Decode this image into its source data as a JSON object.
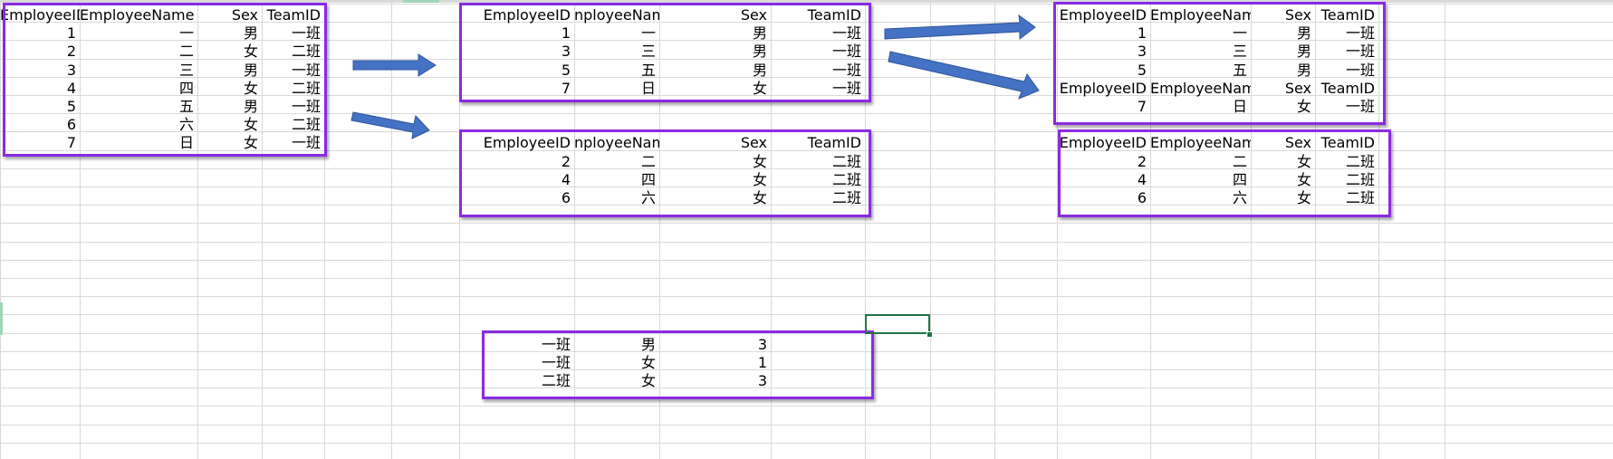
{
  "colors": {
    "highlight_border": "#8a2be2",
    "arrow_fill": "#4472c4",
    "selection": "#217346",
    "gridline": "#d9d9d9"
  },
  "sheet": {
    "source_table": {
      "headers": [
        "EmployeeID",
        "EmployeeName",
        "Sex",
        "TeamID"
      ],
      "rows": [
        [
          "1",
          "一",
          "男",
          "一班"
        ],
        [
          "2",
          "二",
          "女",
          "二班"
        ],
        [
          "3",
          "三",
          "男",
          "一班"
        ],
        [
          "4",
          "四",
          "女",
          "二班"
        ],
        [
          "5",
          "五",
          "男",
          "一班"
        ],
        [
          "6",
          "六",
          "女",
          "二班"
        ],
        [
          "7",
          "日",
          "女",
          "一班"
        ]
      ]
    },
    "team1_table": {
      "headers": [
        "EmployeeID",
        "nployeeName",
        "Sex",
        "TeamID"
      ],
      "rows": [
        [
          "1",
          "一",
          "男",
          "一班"
        ],
        [
          "3",
          "三",
          "男",
          "一班"
        ],
        [
          "5",
          "五",
          "男",
          "一班"
        ],
        [
          "7",
          "日",
          "女",
          "一班"
        ]
      ]
    },
    "team2_table": {
      "headers": [
        "EmployeeID",
        "nployeeName",
        "Sex",
        "TeamID"
      ],
      "rows": [
        [
          "2",
          "二",
          "女",
          "二班"
        ],
        [
          "4",
          "四",
          "女",
          "二班"
        ],
        [
          "6",
          "六",
          "女",
          "二班"
        ]
      ]
    },
    "team1_male_table": {
      "headers": [
        "EmployeeID",
        "EmployeeName",
        "Sex",
        "TeamID"
      ],
      "rows": [
        [
          "1",
          "一",
          "男",
          "一班"
        ],
        [
          "3",
          "三",
          "男",
          "一班"
        ],
        [
          "5",
          "五",
          "男",
          "一班"
        ]
      ]
    },
    "team1_female_table": {
      "headers": [
        "EmployeeID",
        "EmployeeName",
        "Sex",
        "TeamID"
      ],
      "rows": [
        [
          "7",
          "日",
          "女",
          "一班"
        ]
      ]
    },
    "team2_female_table": {
      "headers": [
        "EmployeeID",
        "EmployeeName",
        "Sex",
        "TeamID"
      ],
      "rows": [
        [
          "2",
          "二",
          "女",
          "二班"
        ],
        [
          "4",
          "四",
          "女",
          "二班"
        ],
        [
          "6",
          "六",
          "女",
          "二班"
        ]
      ]
    },
    "summary_table": {
      "rows": [
        [
          "一班",
          "男",
          "3"
        ],
        [
          "一班",
          "女",
          "1"
        ],
        [
          "二班",
          "女",
          "3"
        ]
      ]
    }
  }
}
